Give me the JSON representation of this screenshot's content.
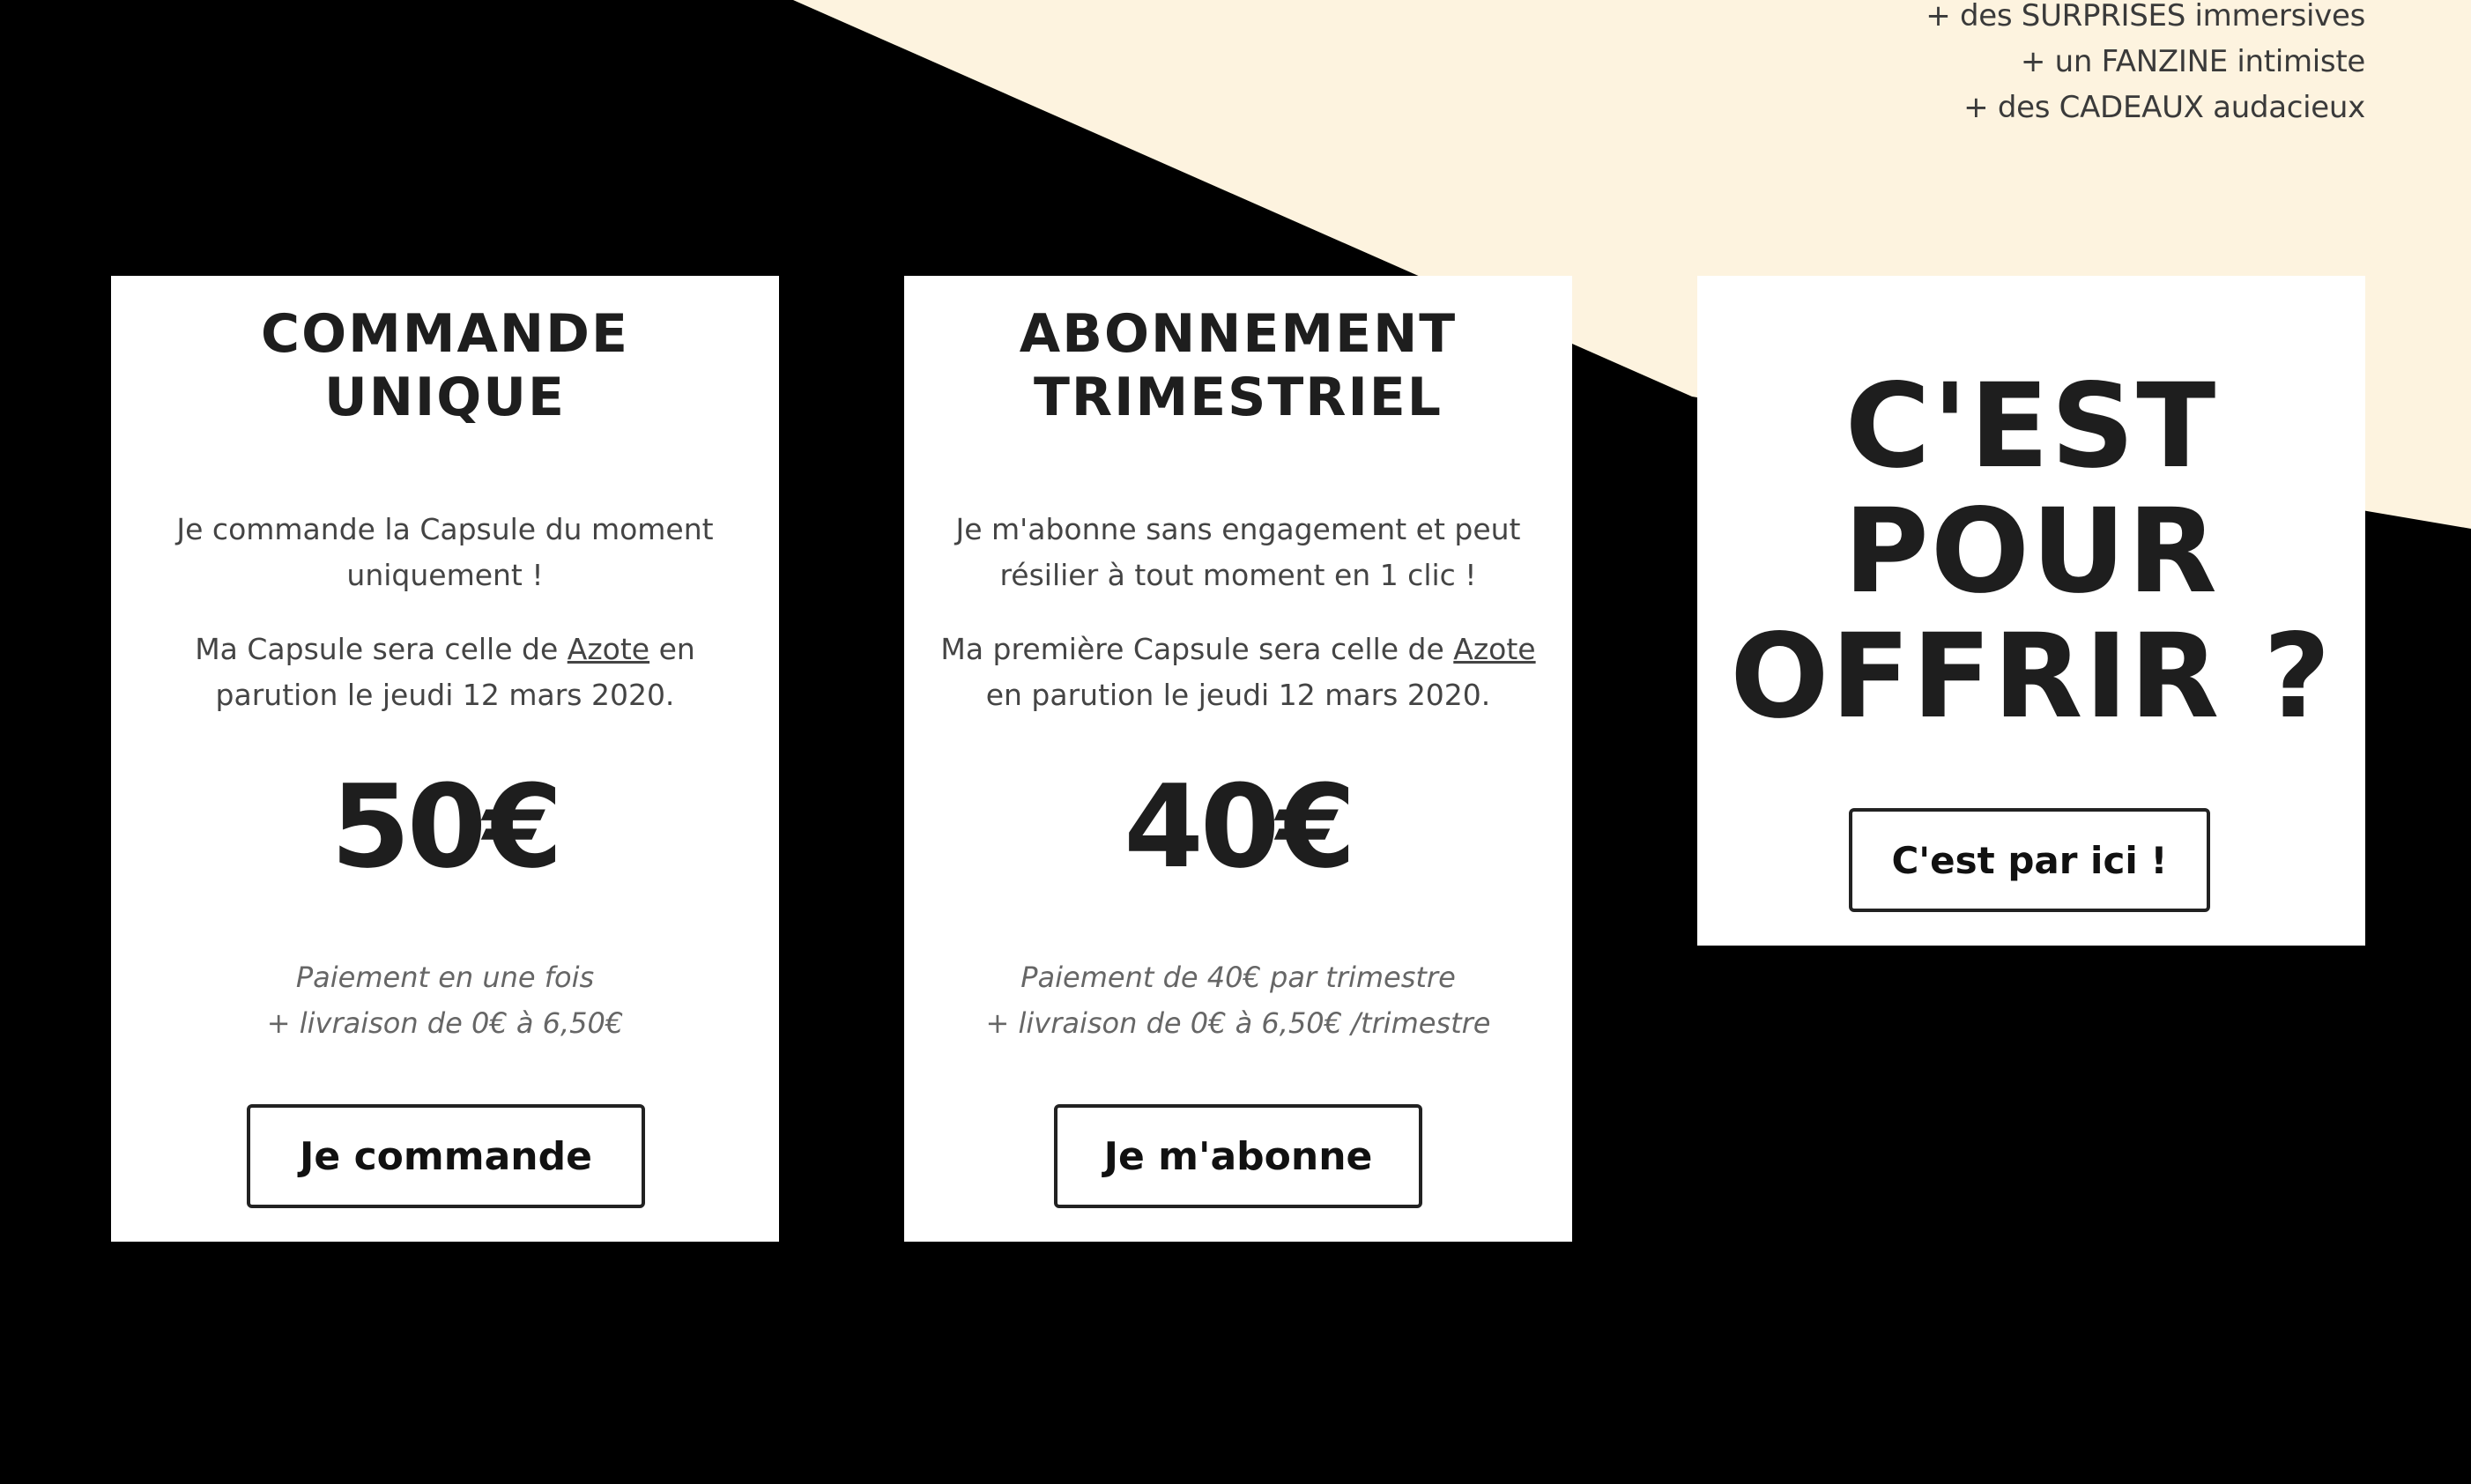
{
  "colors": {
    "background": "#000000",
    "accent_shape": "#fdf3df",
    "card": "#ffffff",
    "text": "#1e1e1e"
  },
  "perks": [
    "+ des SURPRISES immersives",
    "+ un FANZINE intimiste",
    "+ des CADEAUX audacieux"
  ],
  "card_unique": {
    "title_line1": "COMMANDE",
    "title_line2": "UNIQUE",
    "desc1": "Je commande la Capsule du moment uniquement !",
    "desc2_pre": "Ma Capsule sera celle de ",
    "desc2_link": "Azote",
    "desc2_post": " en parution le jeudi 12 mars 2020.",
    "price": "50€",
    "note_line1": "Paiement en une fois",
    "note_line2": "+ livraison de 0€ à 6,50€",
    "button": "Je commande"
  },
  "card_subscription": {
    "title_line1": "ABONNEMENT",
    "title_line2": "TRIMESTRIEL",
    "desc1": "Je m'abonne sans engagement et peut résilier à tout moment en 1 clic !",
    "desc2_pre": "Ma première Capsule sera celle de ",
    "desc2_link": "Azote",
    "desc2_post": " en parution le jeudi 12 mars 2020.",
    "price": "40€",
    "note_line1": "Paiement de 40€ par trimestre",
    "note_line2": "+ livraison de 0€ à 6,50€ /trimestre",
    "button": "Je m'abonne"
  },
  "card_gift": {
    "title_line1": "C'EST",
    "title_line2": "POUR",
    "title_line3": "OFFRIR ?",
    "button": "C'est par ici !"
  }
}
